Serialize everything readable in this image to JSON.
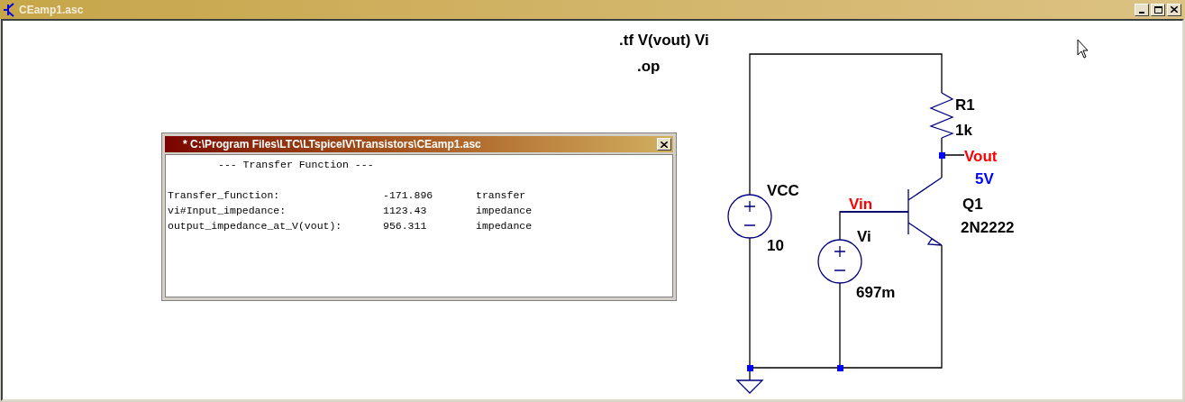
{
  "window": {
    "title": "CEamp1.asc"
  },
  "schematic": {
    "directives": [
      ".tf V(vout) Vi",
      ".op"
    ],
    "labels": [
      {
        "text": "R1",
        "kind": "component"
      },
      {
        "text": "1k",
        "kind": "component"
      },
      {
        "text": "Vout",
        "kind": "net"
      },
      {
        "text": "5V",
        "kind": "op_value"
      },
      {
        "text": "VCC",
        "kind": "component"
      },
      {
        "text": "10",
        "kind": "component"
      },
      {
        "text": "Vin",
        "kind": "net"
      },
      {
        "text": "Q1",
        "kind": "component"
      },
      {
        "text": "2N2222",
        "kind": "component"
      },
      {
        "text": "Vi",
        "kind": "component"
      },
      {
        "text": "697m",
        "kind": "component"
      }
    ]
  },
  "output_window": {
    "title": "* C:\\Program Files\\LTC\\LTspiceIV\\Transistors\\CEamp1.asc",
    "heading": "--- Transfer Function ---",
    "rows": [
      {
        "name": "Transfer_function:",
        "value": "-171.896",
        "unit": "transfer"
      },
      {
        "name": "vi#Input_impedance:",
        "value": "1123.43",
        "unit": "impedance"
      },
      {
        "name": "output_impedance_at_V(vout):",
        "value": "956.311",
        "unit": "impedance"
      }
    ]
  }
}
